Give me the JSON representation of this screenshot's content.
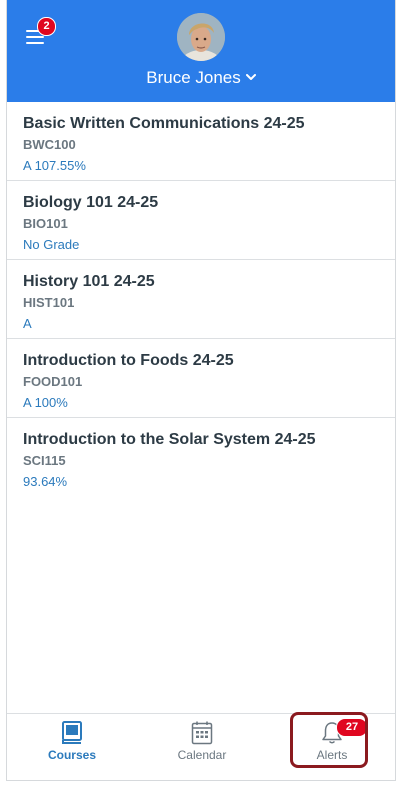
{
  "header": {
    "menu_badge_count": "2",
    "user_name": "Bruce Jones",
    "accent_color": "#2b7de9",
    "menu_icon": "hamburger-menu-icon",
    "dropdown_icon": "chevron-down-icon"
  },
  "courses": [
    {
      "title": "Basic Written Communications 24-25",
      "code": "BWC100",
      "grade": "A  107.55%"
    },
    {
      "title": "Biology 101 24-25",
      "code": "BIO101",
      "grade": "No Grade"
    },
    {
      "title": "History 101 24-25",
      "code": "HIST101",
      "grade": "A"
    },
    {
      "title": "Introduction to Foods 24-25",
      "code": "FOOD101",
      "grade": "A  100%"
    },
    {
      "title": "Introduction to the Solar System  24-25",
      "code": "SCI115",
      "grade": "93.64%"
    }
  ],
  "tabbar": {
    "tabs": [
      {
        "label": "Courses",
        "icon": "courses-book-icon",
        "active": true
      },
      {
        "label": "Calendar",
        "icon": "calendar-icon",
        "active": false
      },
      {
        "label": "Alerts",
        "icon": "bell-icon",
        "active": false
      }
    ],
    "alerts_badge_count": "27"
  },
  "colors": {
    "badge": "#e0061f",
    "link": "#2b7abc",
    "highlight_box": "#8b1a1f"
  }
}
